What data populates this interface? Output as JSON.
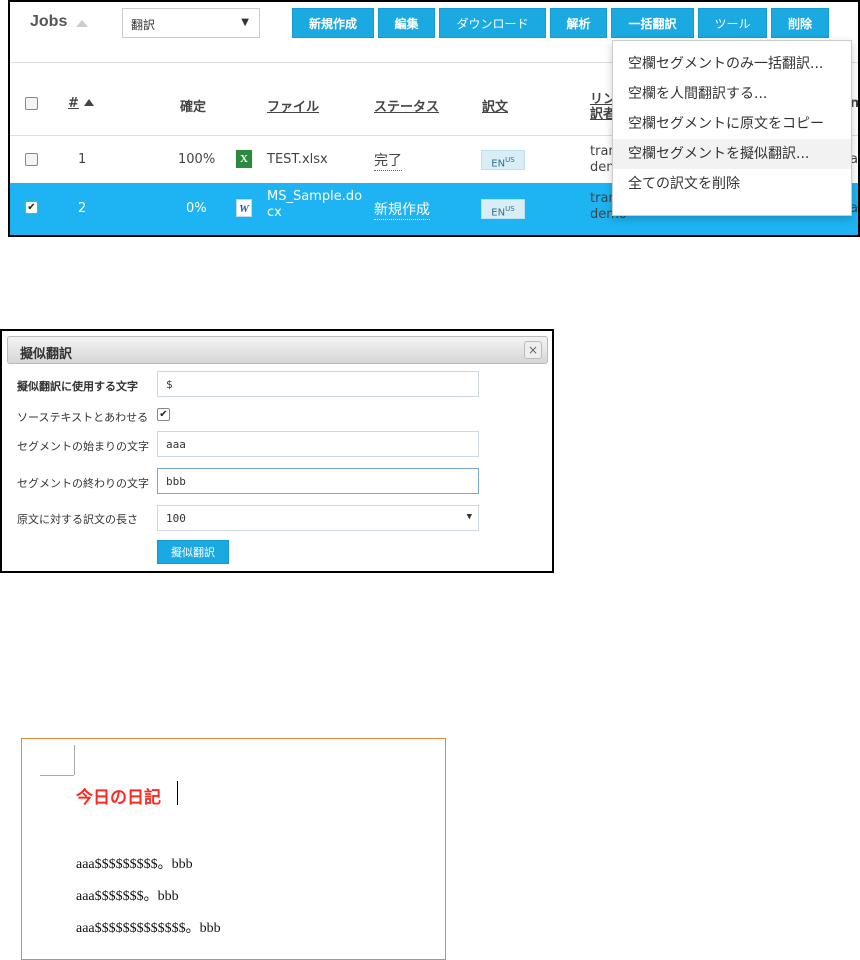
{
  "jobs": {
    "title": "Jobs",
    "filter_value": "翻訳",
    "toolbar": [
      "新規作成",
      "編集",
      "ダウンロード",
      "解析",
      "一括翻訳",
      "ツール",
      "削除"
    ],
    "columns": {
      "number": "#",
      "confirmed": "確定",
      "file": "ファイル",
      "status": "ステータス",
      "target": "訳文",
      "link_a": "リン",
      "link_b": "訳者",
      "extra": "ne"
    },
    "rows": [
      {
        "number": "1",
        "confirmed": "100%",
        "file": "TEST.xlsx",
        "status": "完了",
        "lang": "EN",
        "lang_region": "US",
        "link_a": "tran",
        "link_b": "dem",
        "extra": "ap",
        "checked": false
      },
      {
        "number": "2",
        "confirmed": "0%",
        "file_line1": "MS_Sample.do",
        "file_line2": "cx",
        "status": "新規作成",
        "lang": "EN",
        "lang_region": "US",
        "link_a": "tran",
        "link_b": "demo",
        "extra": "ap",
        "checked": true
      }
    ],
    "menu": [
      "空欄セグメントのみ一括翻訳...",
      "空欄を人間翻訳する...",
      "空欄セグメントに原文をコピー",
      "空欄セグメントを擬似翻訳...",
      "全ての訳文を削除"
    ]
  },
  "dialog": {
    "title": "擬似翻訳",
    "close": "×",
    "fields": {
      "char_label": "擬似翻訳に使用する文字",
      "char_value": "$",
      "match_label": "ソーステキストとあわせる",
      "start_label": "セグメントの始まりの文字",
      "start_value": "aaa",
      "end_label": "セグメントの終わりの文字",
      "end_value": "bbb",
      "length_label": "原文に対する訳文の長さ",
      "length_value": "100"
    },
    "submit": "擬似翻訳"
  },
  "document": {
    "title": "今日の日記",
    "lines": [
      "aaa$$$$$$$$$。bbb",
      "aaa$$$$$$$。bbb",
      "aaa$$$$$$$$$$$$$。bbb"
    ]
  },
  "colors": {
    "accent": "#1ba9e1",
    "selected_row": "#1eb3f2",
    "doc_title": "#ff2a1f",
    "doc_border": "#e08a3a"
  }
}
